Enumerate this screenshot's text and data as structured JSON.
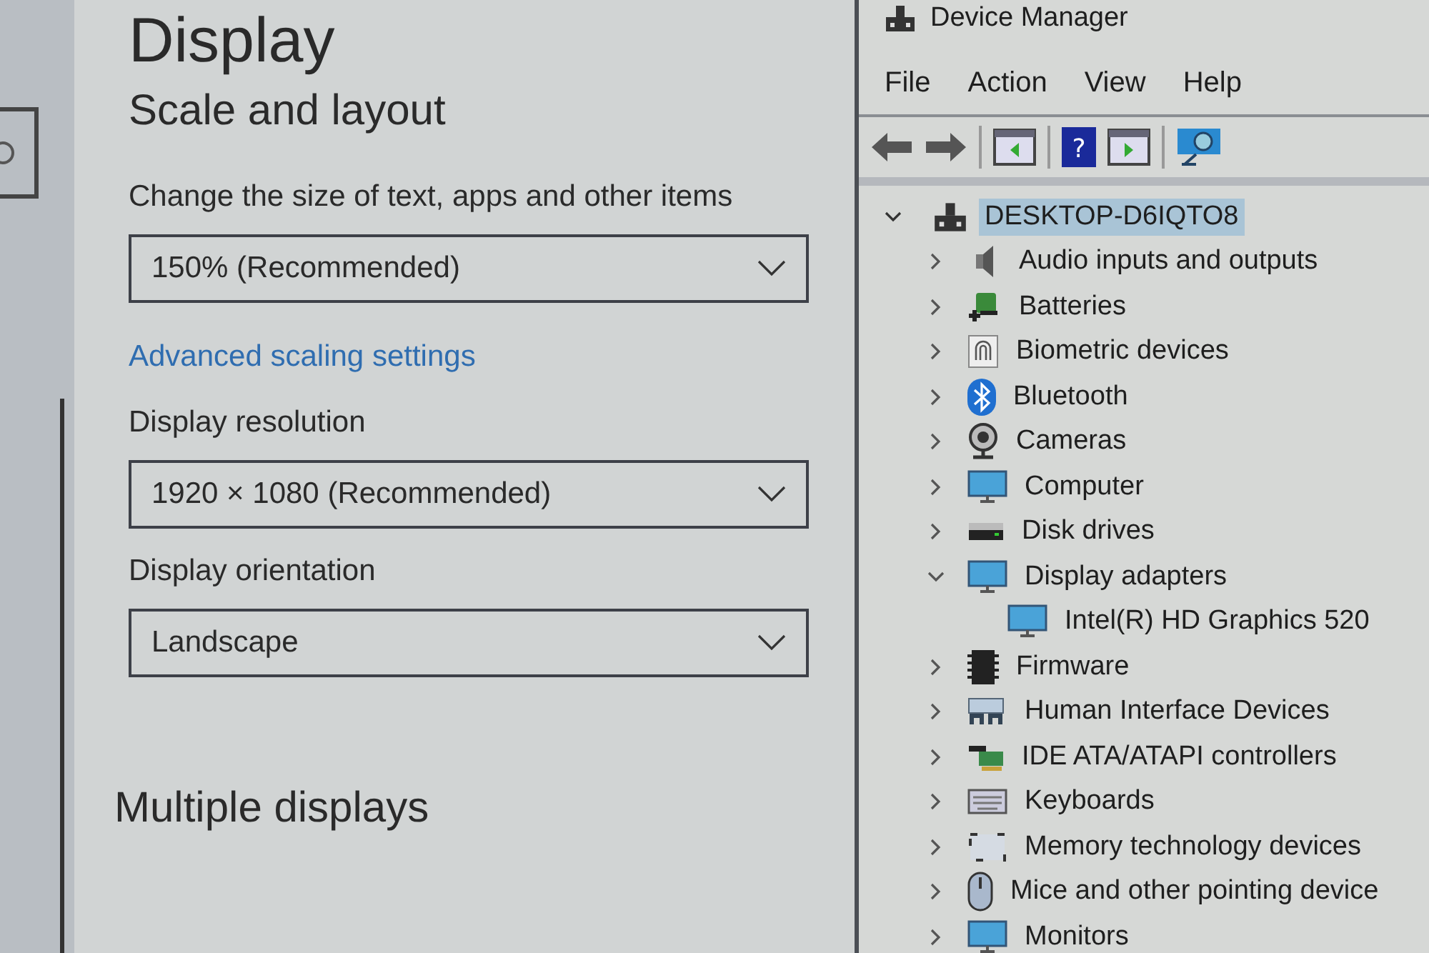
{
  "settings": {
    "title": "Display",
    "section": "Scale and layout",
    "scale_label": "Change the size of text, apps and other items",
    "scale_value": "150% (Recommended)",
    "advanced_link": "Advanced scaling settings",
    "resolution_label": "Display resolution",
    "resolution_value": "1920 × 1080 (Recommended)",
    "orientation_label": "Display orientation",
    "orientation_value": "Landscape",
    "next_section": "Multiple displays"
  },
  "device_manager": {
    "title": "Device Manager",
    "menu": [
      "File",
      "Action",
      "View",
      "Help"
    ],
    "help_glyph": "?",
    "tree": {
      "label": "DESKTOP-D6IQTO8",
      "selected": true,
      "expanded": true,
      "children": [
        {
          "label": "Audio inputs and outputs",
          "expanded": false
        },
        {
          "label": "Batteries",
          "expanded": false
        },
        {
          "label": "Biometric devices",
          "expanded": false
        },
        {
          "label": "Bluetooth",
          "expanded": false
        },
        {
          "label": "Cameras",
          "expanded": false
        },
        {
          "label": "Computer",
          "expanded": false
        },
        {
          "label": "Disk drives",
          "expanded": false
        },
        {
          "label": "Display adapters",
          "expanded": true,
          "children": [
            {
              "label": "Intel(R) HD Graphics 520"
            }
          ]
        },
        {
          "label": "Firmware",
          "expanded": false
        },
        {
          "label": "Human Interface Devices",
          "expanded": false
        },
        {
          "label": "IDE ATA/ATAPI controllers",
          "expanded": false
        },
        {
          "label": "Keyboards",
          "expanded": false
        },
        {
          "label": "Memory technology devices",
          "expanded": false
        },
        {
          "label": "Mice and other pointing device",
          "expanded": false
        },
        {
          "label": "Monitors",
          "expanded": false
        }
      ]
    }
  }
}
